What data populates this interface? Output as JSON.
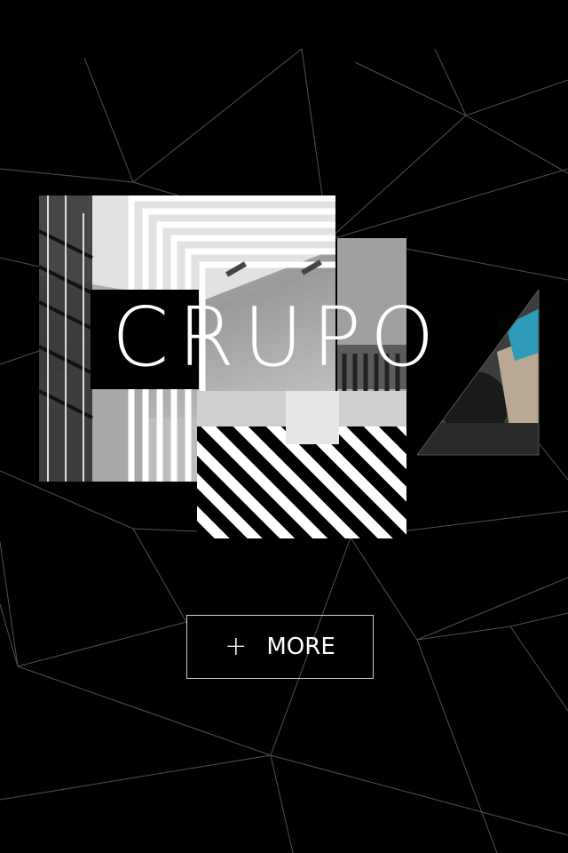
{
  "hero": {
    "logo_text": "CRUPO"
  },
  "more_button": {
    "icon": "plus-icon",
    "icon_glyph": "+",
    "label": "MORE"
  },
  "colors": {
    "background": "#000000",
    "foreground": "#ffffff",
    "lines": "#5a5a5a"
  }
}
